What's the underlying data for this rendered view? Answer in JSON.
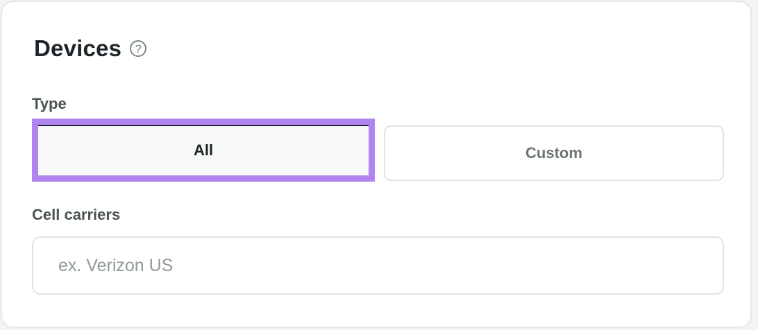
{
  "devices": {
    "title": "Devices",
    "help_icon": "question-circle-icon",
    "help_glyph": "?"
  },
  "type": {
    "label": "Type",
    "options": [
      "All",
      "Custom"
    ],
    "selected": "All"
  },
  "cell_carriers": {
    "label": "Cell carriers",
    "value": "",
    "placeholder": "ex. Verizon US"
  },
  "colors": {
    "focus_ring": "#b185f0",
    "heading": "#1e2528",
    "label": "#4a5356",
    "border": "#e1e4e5"
  }
}
